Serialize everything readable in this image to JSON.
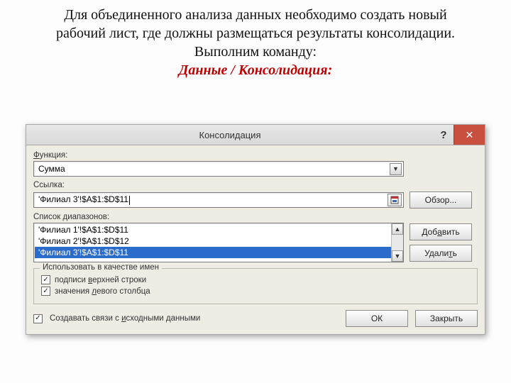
{
  "slide": {
    "p1": "Для объединенного анализа данных необходимо создать новый рабочий лист, где должны размещаться результаты консолидации.",
    "p2": "Выполним команду:",
    "cmd": "Данные / Консолидация:"
  },
  "dialog": {
    "title": "Консолидация",
    "labels": {
      "function_char": "Ф",
      "function_rest": "ункция:",
      "reference": "Ссылка:",
      "ranges_pre": "Список ",
      "ranges_char": "д",
      "ranges_rest": "иапазонов:",
      "group_legend": "Использовать в качестве имен",
      "top_row_pre": "подписи ",
      "top_row_char": "в",
      "top_row_rest": "ерхней строки",
      "left_col_pre": "значения ",
      "left_col_char": "л",
      "left_col_rest": "евого столбца",
      "links_pre": "Создавать связи с ",
      "links_char": "и",
      "links_rest": "сходными данными"
    },
    "function_value": "Сумма",
    "reference_value": "'Филиал 3'!$A$1:$D$11",
    "ranges": [
      "'Филиал 1'!$A$1:$D$11",
      "'Филиал 2'!$A$1:$D$12",
      "'Филиал 3'!$A$1:$D$11"
    ],
    "selected_range_index": 2,
    "checks": {
      "top_row": true,
      "left_col": true,
      "create_links": true
    },
    "buttons": {
      "browse": "Обзор...",
      "add_pre": "Доб",
      "add_char": "а",
      "add_rest": "вить",
      "delete_pre": "Удали",
      "delete_char": "т",
      "delete_rest": "ь",
      "ok": "ОК",
      "close": "Закрыть"
    },
    "icons": {
      "help": "?",
      "close": "✕",
      "check": "✓",
      "down": "▼",
      "up": "▲"
    }
  }
}
